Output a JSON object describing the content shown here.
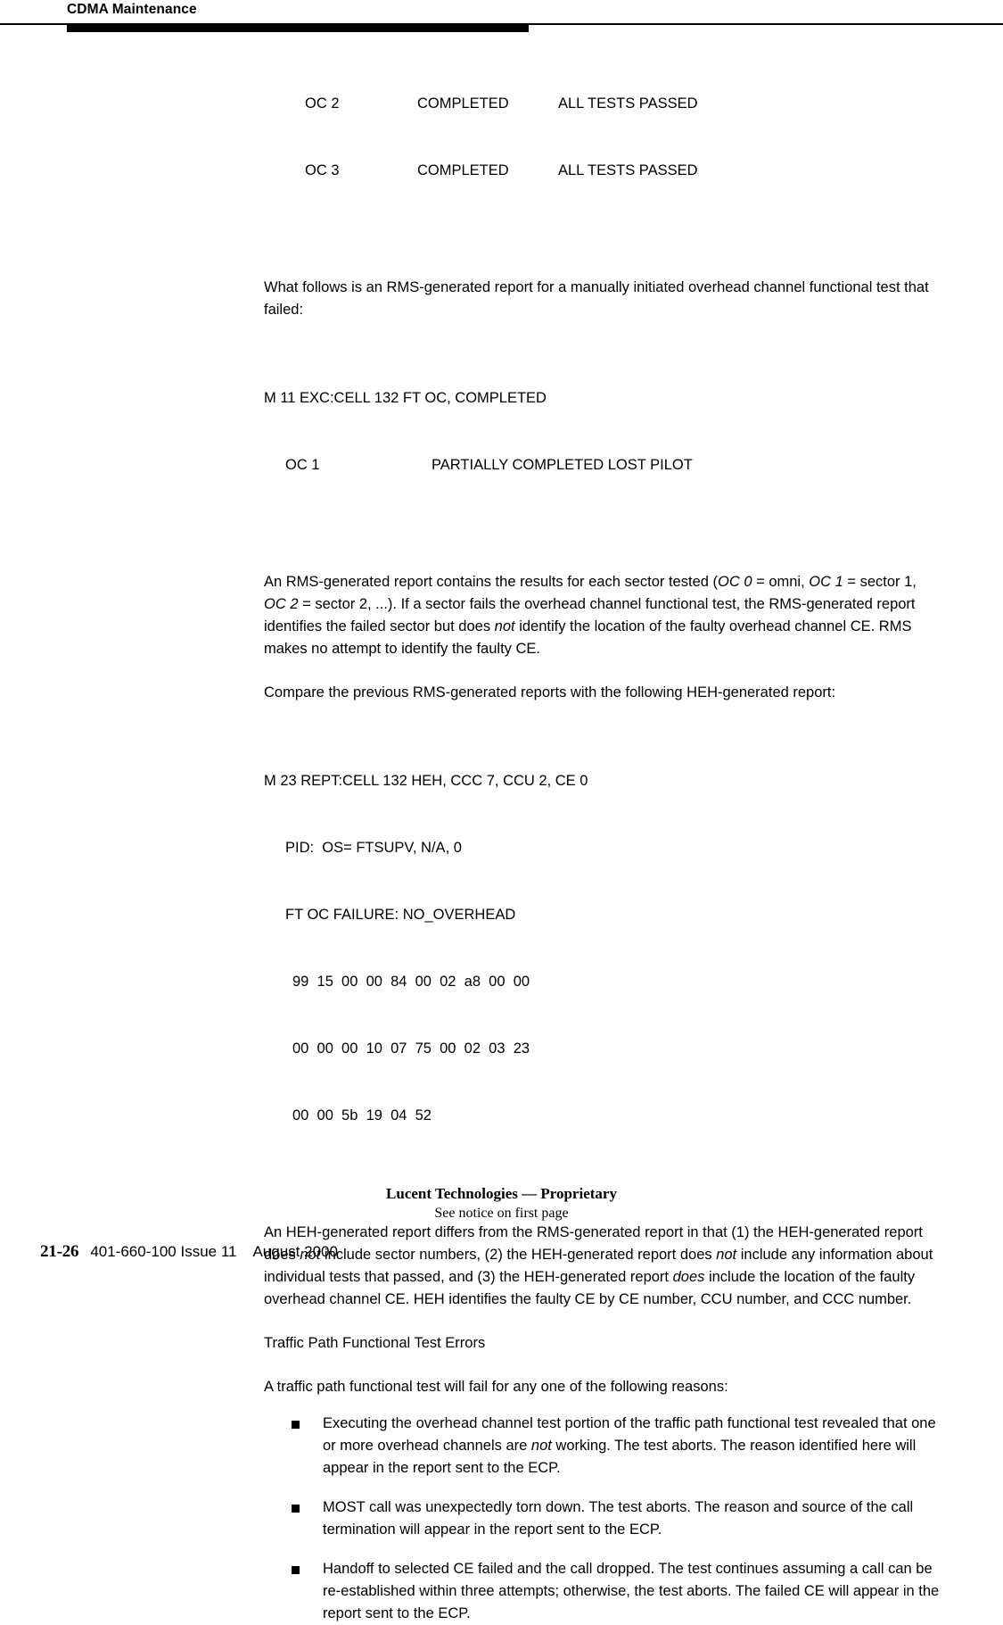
{
  "header": {
    "title": "CDMA Maintenance"
  },
  "report_top": {
    "rows": [
      {
        "label": "OC 2",
        "status": "COMPLETED",
        "result": "ALL TESTS PASSED"
      },
      {
        "label": "OC 3",
        "status": "COMPLETED",
        "result": "ALL TESTS PASSED"
      }
    ]
  },
  "intro_paragraph": "What follows is an RMS-generated report for a manually initiated overhead channel functional test that failed:",
  "report_rms": {
    "header_line": "M 11 EXC:CELL 132 FT OC, COMPLETED",
    "rows": [
      {
        "label": "OC 1",
        "status": "PARTIALLY COMPLETED LOST PILOT"
      }
    ]
  },
  "paragraph_sectors": {
    "part1": "An RMS-generated report contains the results for each sector tested (",
    "em1": "OC 0",
    "part2": " = omni, ",
    "em2": "OC 1",
    "part3": " = sector 1, ",
    "em3": "OC 2",
    "part4": " = sector 2, ...). If a sector fails the overhead channel functional test, the RMS-generated report identifies the failed sector but does ",
    "em4": "not",
    "part5": " identify the location of the faulty overhead channel CE. RMS makes no attempt to identify the faulty CE."
  },
  "paragraph_compare": "Compare the previous RMS-generated reports with the following HEH-generated report:",
  "report_heh": {
    "line1": "M 23 REPT:CELL 132 HEH, CCC 7, CCU 2, CE 0",
    "line2": "PID:  OS= FTSUPV, N/A, 0",
    "line3": "FT OC FAILURE: NO_OVERHEAD",
    "hex_rows": [
      "99  15  00  00  84  00  02  a8  00  00",
      "00  00  00  10  07  75  00  02  03  23",
      "00  00  5b  19  04  52"
    ]
  },
  "paragraph_differs": {
    "part1": "An HEH-generated report differs from the RMS-generated report in that (1) the HEH-generated report does ",
    "em1": "not",
    "part2": " include sector numbers, (2) the HEH-generated report does ",
    "em2": "not",
    "part3": " include any information about individual tests that passed, and (3) the HEH-generated report ",
    "em3": "does",
    "part4": " include the location of the faulty overhead channel CE. HEH identifies the faulty CE by CE number, CCU number, and CCC number."
  },
  "section_heading": "Traffic Path Functional Test Errors",
  "paragraph_reasons": "A traffic path functional test will fail for any one of the following reasons:",
  "bullets": [
    {
      "part1": "Executing the overhead channel test portion of the traffic path functional test revealed that one or more overhead channels are ",
      "em1": "not",
      "part2": " working. The test aborts. The reason identified here will appear in the report sent to the ECP."
    },
    {
      "part1": "MOST call was unexpectedly torn down. The test aborts. The reason and source of the call termination will appear in the report sent to the ECP.",
      "em1": "",
      "part2": ""
    },
    {
      "part1": "Handoff to selected CE failed and the call dropped. The test continues assuming a call can be re-established within three attempts; otherwise, the test aborts. The failed CE will appear in the report sent to the ECP.",
      "em1": "",
      "part2": ""
    }
  ],
  "footer": {
    "proprietary": "Lucent Technologies — Proprietary",
    "notice": "See notice on first page",
    "page_number": "21-26",
    "document_id": "401-660-100 Issue 11",
    "date": "August 2000"
  }
}
